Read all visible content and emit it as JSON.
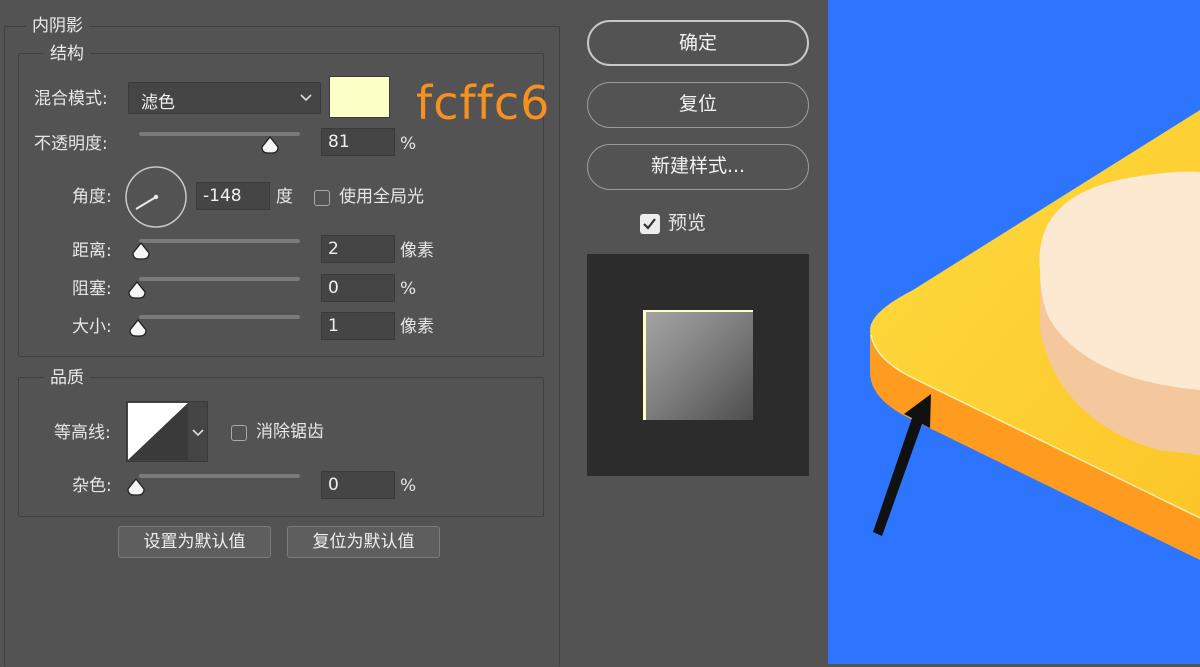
{
  "inner_shadow": {
    "title": "内阴影",
    "structure": {
      "title": "结构",
      "blend_mode": {
        "label": "混合模式:",
        "value": "滤色"
      },
      "color": {
        "swatch": "#fcffc6",
        "annotation": "fcffc6",
        "annotation_color": "#f7901e"
      },
      "opacity": {
        "label": "不透明度:",
        "value": "81",
        "unit": "%",
        "level": 0.81
      },
      "angle": {
        "label": "角度:",
        "value": "-148",
        "unit": "度",
        "degrees": -148
      },
      "use_global_light": {
        "label": "使用全局光",
        "checked": false
      },
      "distance": {
        "label": "距离:",
        "value": "2",
        "unit": "像素",
        "level": 0.02
      },
      "choke": {
        "label": "阻塞:",
        "value": "0",
        "unit": "%",
        "level": 0
      },
      "size": {
        "label": "大小:",
        "value": "1",
        "unit": "像素",
        "level": 0.01
      }
    },
    "quality": {
      "title": "品质",
      "contour": {
        "label": "等高线:"
      },
      "anti_aliased": {
        "label": "消除锯齿",
        "checked": false
      },
      "noise": {
        "label": "杂色:",
        "value": "0",
        "unit": "%",
        "level": 0
      }
    },
    "buttons": {
      "make_default": "设置为默认值",
      "reset_default": "复位为默认值"
    }
  },
  "side_panel": {
    "ok": "确定",
    "reset": "复位",
    "new_style": "新建样式...",
    "preview": {
      "label": "预览",
      "checked": true
    }
  },
  "canvas": {
    "background": "#2d74fe",
    "top_face": "#fdd532",
    "side_face": "#ff9b1f",
    "cylinder_top": "#fde8d2",
    "cylinder_side": "#f4c79c"
  }
}
